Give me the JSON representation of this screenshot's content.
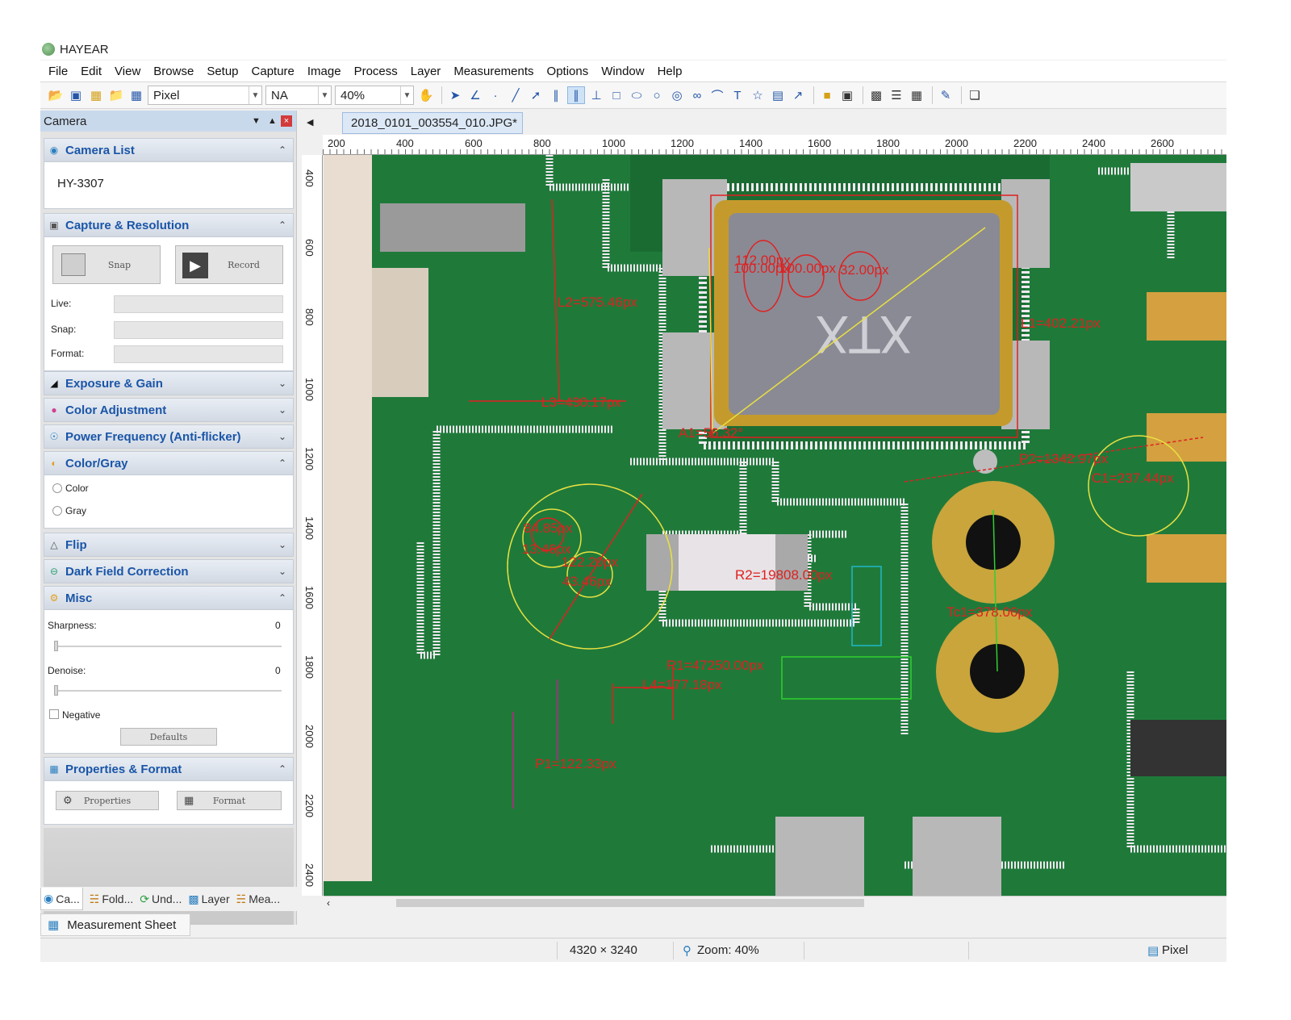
{
  "app": {
    "title": "HAYEAR"
  },
  "menu": [
    "File",
    "Edit",
    "View",
    "Browse",
    "Setup",
    "Capture",
    "Image",
    "Process",
    "Layer",
    "Measurements",
    "Options",
    "Window",
    "Help"
  ],
  "toolbar": {
    "unit_value": "Pixel",
    "mag_value": "NA",
    "zoom_value": "40%"
  },
  "left_panel": {
    "title": "Camera",
    "camera_list": {
      "title": "Camera List",
      "item": "HY-3307"
    },
    "capture": {
      "title": "Capture & Resolution",
      "snap": "Snap",
      "record": "Record",
      "live_label": "Live:",
      "snap_label": "Snap:",
      "format_label": "Format:"
    },
    "exposure": {
      "title": "Exposure & Gain"
    },
    "color_adj": {
      "title": "Color Adjustment"
    },
    "power": {
      "title": "Power Frequency (Anti-flicker)"
    },
    "color_gray": {
      "title": "Color/Gray",
      "color": "Color",
      "gray": "Gray"
    },
    "flip": {
      "title": "Flip"
    },
    "dark": {
      "title": "Dark Field Correction"
    },
    "misc": {
      "title": "Misc",
      "sharpness_label": "Sharpness:",
      "sharpness_value": "0",
      "denoise_label": "Denoise:",
      "denoise_value": "0",
      "negative_label": "Negative",
      "defaults": "Defaults"
    },
    "props": {
      "title": "Properties & Format",
      "properties": "Properties",
      "format": "Format"
    },
    "tabs": [
      "Ca...",
      "Fold...",
      "Und...",
      "Layer",
      "Mea..."
    ],
    "sheet_tab": "Measurement Sheet"
  },
  "document": {
    "tab": "2018_0101_003554_010.JPG*",
    "h_ruler": [
      "200",
      "400",
      "600",
      "800",
      "1000",
      "1200",
      "1400",
      "1600",
      "1800",
      "2000",
      "2200",
      "2400",
      "2600"
    ],
    "v_ruler": [
      "400",
      "600",
      "800",
      "1000",
      "1200",
      "1400",
      "1600",
      "1800",
      "2000",
      "2200",
      "2400"
    ],
    "marks": {
      "board_text": "XTX",
      "l2": "L2=575.46px",
      "l1": "L1=402.21px",
      "l3": "L3=430.17px",
      "a1": "A1=56.32°",
      "p2": "P2=1342.97px",
      "c1": "C1=237.44px",
      "r2": "R2=19808.00px",
      "tc1": "Tc1=378.06px",
      "r1": "R1=47250.00px",
      "l4": "L4=177.18px",
      "p1": "P1=122.33px",
      "c_a": "84.85px",
      "c_b": "122.20px",
      "c_c": "13.46px",
      "c_d": "43.46px",
      "top_a": "112.00px",
      "top_b": "100.00px",
      "top_c": "100.00px",
      "top_d": "32.00px"
    }
  },
  "status": {
    "size": "4320 × 3240",
    "zoom": "Zoom: 40%",
    "unit": "Pixel"
  },
  "colors": {
    "pcb_green": "#1f7a3a",
    "measure_red": "#e02020",
    "measure_yellow": "#e8e040",
    "panel_title": "#1a55a8"
  }
}
